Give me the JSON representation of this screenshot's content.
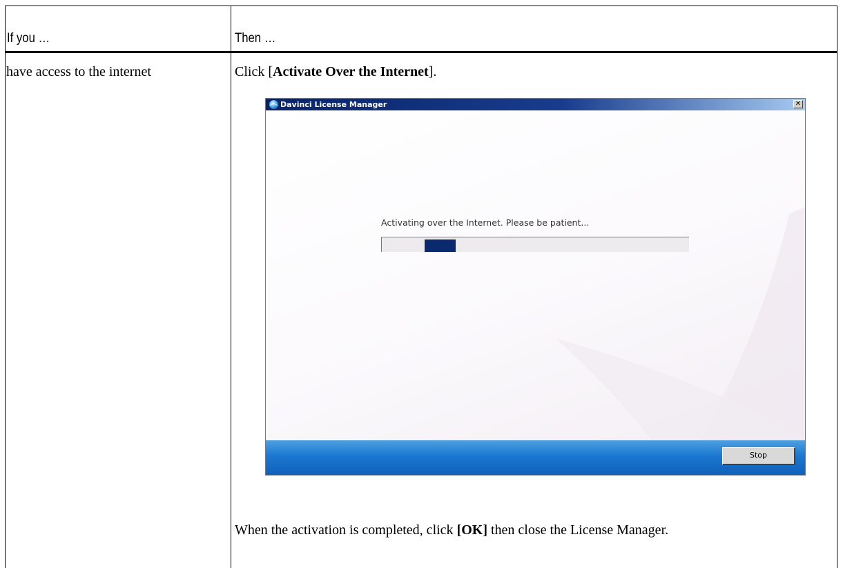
{
  "table": {
    "header": {
      "left": "If you …",
      "right": "Then …"
    },
    "row1": {
      "condition": "have access to the internet",
      "instruction_prefix": "Click [",
      "instruction_bold": "Activate Over the Internet",
      "instruction_suffix": "].",
      "followup_prefix": "When the activation is completed, click ",
      "followup_bold": "[OK]",
      "followup_suffix": " then close the License Manager."
    }
  },
  "dialog": {
    "title": "Davinci License Manager",
    "close_glyph": "✕",
    "status_text": "Activating over the Internet. Please be patient...",
    "progress": {
      "chunk_start_fraction": 0.14,
      "chunk_end_fraction": 0.24
    },
    "stop_label": "Stop",
    "colors": {
      "progress_chunk": "#0b2a6e",
      "bottom_bar": "#1b78d0"
    }
  },
  "icons": {
    "title_icon": "app-globe-icon",
    "close": "close-icon"
  }
}
